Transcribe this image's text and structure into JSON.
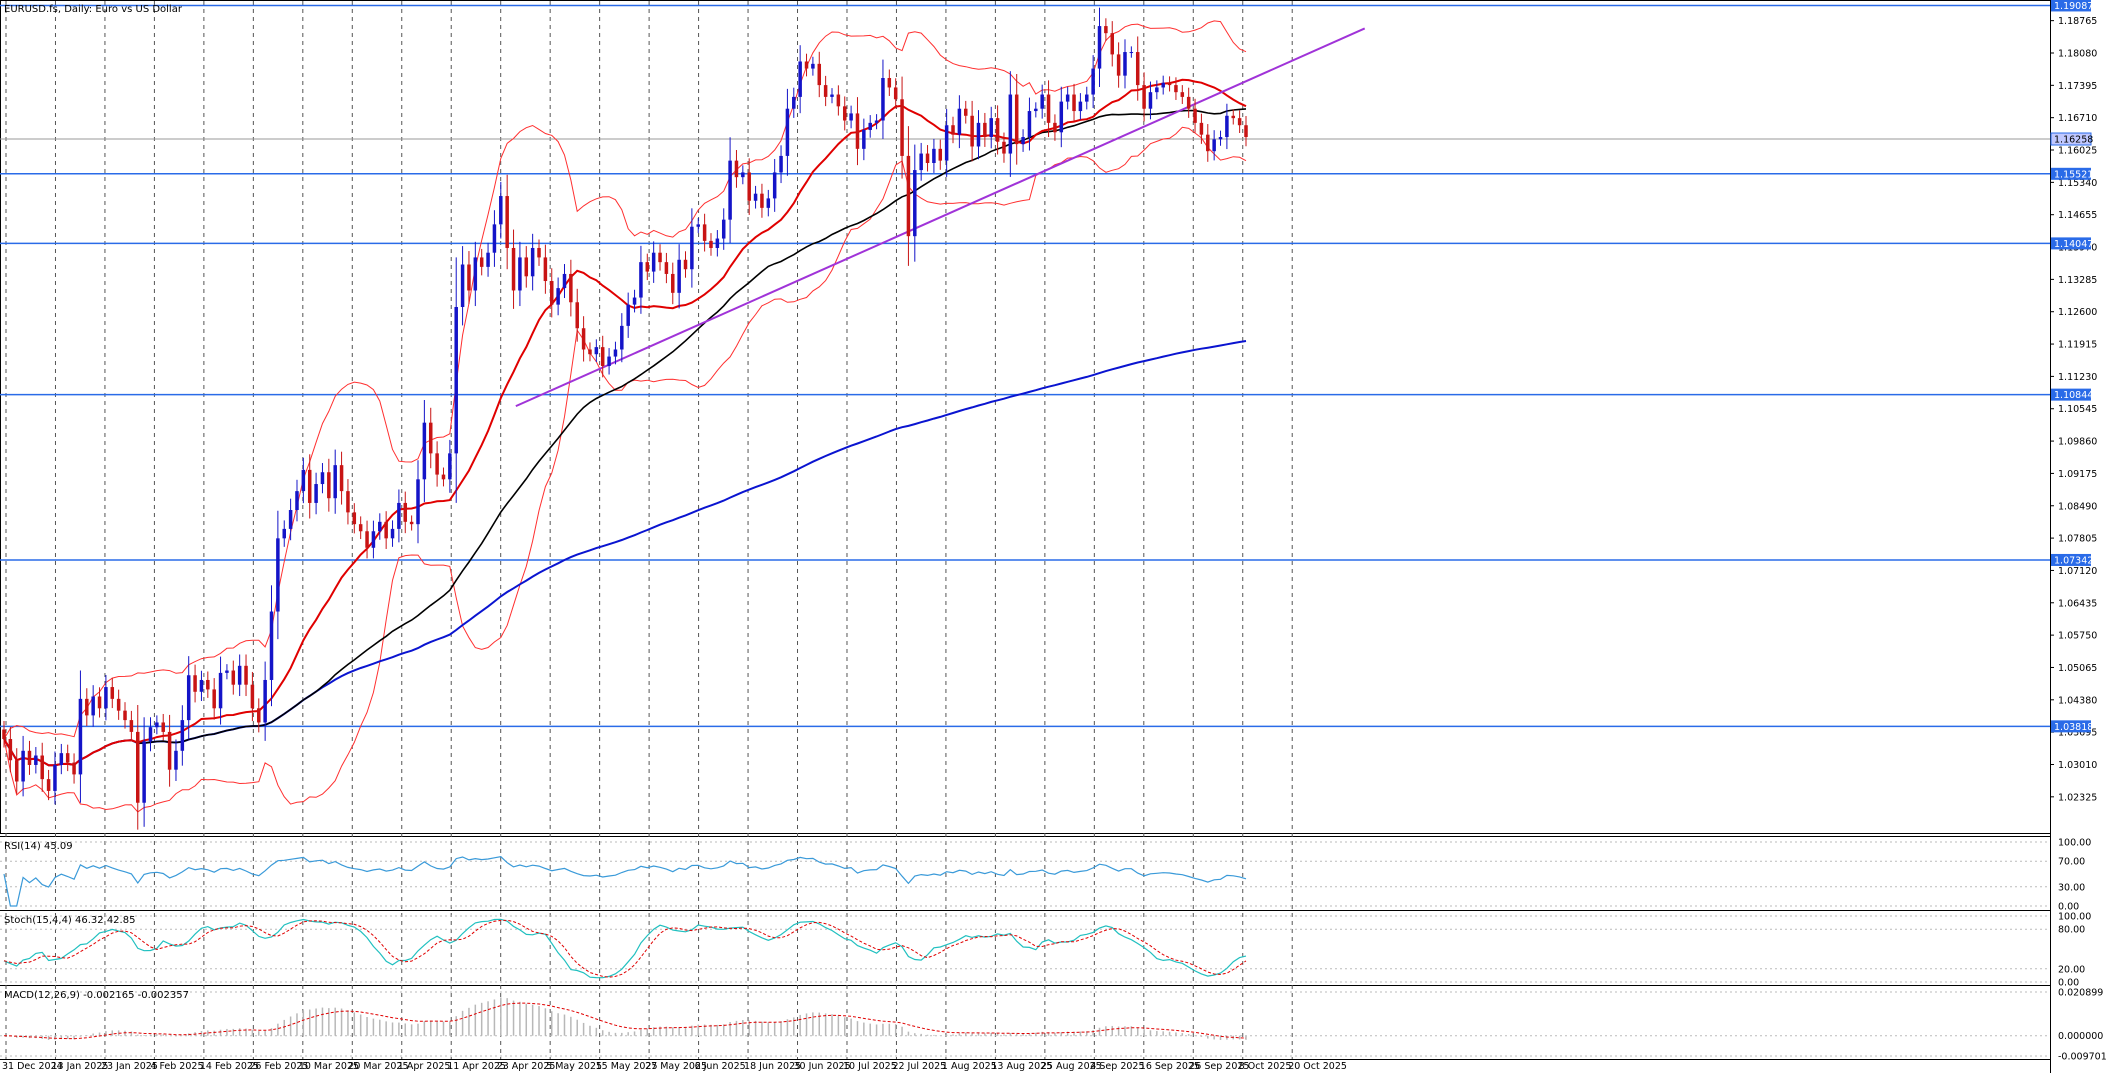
{
  "chart_title": "EURUSD.fs, Daily:  Euro vs US Dollar",
  "colors": {
    "bull": "#1414c8",
    "bear": "#c81414",
    "bb": "#ff3030",
    "ma_fast": "#e00000",
    "ma_mid": "#000000",
    "ma_slow": "#0a14d0",
    "trend": "#a033d8",
    "hlines": "#2a6be8",
    "rsi": "#3a9ad9",
    "stoch_main": "#21c0c0",
    "stoch_signal": "#e00000",
    "macd_hist": "#b8b8b8",
    "macd_signal": "#e00000"
  },
  "chart_data": {
    "type": "candlestick",
    "price_axis_labels": [
      "1.18765",
      "1.18080",
      "1.17395",
      "1.16710",
      "1.16025",
      "1.15340",
      "1.14655",
      "1.13970",
      "1.13285",
      "1.12600",
      "1.11915",
      "1.11230",
      "1.10545",
      "1.09860",
      "1.09175",
      "1.08490",
      "1.07805",
      "1.07120",
      "1.06435",
      "1.05750",
      "1.05065",
      "1.04380",
      "1.03695",
      "1.03010",
      "1.02325"
    ],
    "ylim": [
      1.0158,
      1.1916
    ],
    "horizontal_levels": [
      "1.19087",
      "1.15521",
      "1.14047",
      "1.10844",
      "1.07342",
      "1.03818"
    ],
    "current_price": "1.16258",
    "date_labels": [
      "31 Dec 2024",
      "13 Jan 2025",
      "23 Jan 2025",
      "4 Feb 2025",
      "14 Feb 2025",
      "26 Feb 2025",
      "10 Mar 2025",
      "20 Mar 2025",
      "1 Apr 2025",
      "11 Apr 2025",
      "23 Apr 2025",
      "5 May 2025",
      "15 May 2025",
      "27 May 2025",
      "6 Jun 2025",
      "18 Jun 2025",
      "30 Jun 2025",
      "10 Jul 2025",
      "22 Jul 2025",
      "1 Aug 2025",
      "13 Aug 2025",
      "25 Aug 2025",
      "4 Sep 2025",
      "16 Sep 2025",
      "26 Sep 2025",
      "8 Oct 2025",
      "20 Oct 2025"
    ],
    "closes": [
      1.0355,
      1.031,
      1.0265,
      1.033,
      1.03,
      1.032,
      1.027,
      1.0245,
      1.03,
      1.0325,
      1.0305,
      1.028,
      1.044,
      1.0405,
      1.0445,
      1.042,
      1.0465,
      1.044,
      1.0415,
      1.0395,
      1.037,
      1.022,
      1.035,
      1.038,
      1.039,
      1.037,
      1.029,
      1.033,
      1.0395,
      1.049,
      1.0455,
      1.048,
      1.046,
      1.042,
      1.0495,
      1.05,
      1.047,
      1.051,
      1.047,
      1.042,
      1.039,
      1.048,
      1.0625,
      1.078,
      1.08,
      1.084,
      1.088,
      1.0925,
      1.0855,
      1.0895,
      1.092,
      1.0865,
      1.0935,
      1.088,
      1.0835,
      1.081,
      1.0795,
      1.076,
      1.0795,
      1.0815,
      1.078,
      1.08,
      1.0855,
      1.0815,
      1.081,
      1.0905,
      1.1025,
      1.096,
      1.0915,
      1.0905,
      1.096,
      1.127,
      1.136,
      1.1305,
      1.1375,
      1.1355,
      1.1385,
      1.1445,
      1.1505,
      1.1395,
      1.1305,
      1.1375,
      1.1335,
      1.1395,
      1.1375,
      1.1325,
      1.1275,
      1.131,
      1.134,
      1.128,
      1.1225,
      1.118,
      1.117,
      1.1185,
      1.1145,
      1.1165,
      1.118,
      1.123,
      1.1275,
      1.129,
      1.1365,
      1.1345,
      1.1385,
      1.1365,
      1.134,
      1.13,
      1.137,
      1.135,
      1.144,
      1.1445,
      1.141,
      1.1395,
      1.1415,
      1.1455,
      1.158,
      1.1545,
      1.1555,
      1.1495,
      1.151,
      1.148,
      1.15,
      1.1555,
      1.159,
      1.169,
      1.1715,
      1.179,
      1.1775,
      1.1785,
      1.174,
      1.1715,
      1.172,
      1.1695,
      1.1665,
      1.168,
      1.1605,
      1.1645,
      1.166,
      1.1665,
      1.1755,
      1.1735,
      1.171,
      1.159,
      1.142,
      1.156,
      1.1595,
      1.1575,
      1.1605,
      1.158,
      1.1655,
      1.1635,
      1.169,
      1.1675,
      1.161,
      1.166,
      1.163,
      1.167,
      1.162,
      1.1595,
      1.172,
      1.1615,
      1.163,
      1.1685,
      1.169,
      1.172,
      1.166,
      1.164,
      1.1705,
      1.172,
      1.1685,
      1.1705,
      1.172,
      1.1775,
      1.1865,
      1.185,
      1.1805,
      1.176,
      1.181,
      1.181,
      1.174,
      1.169,
      1.1725,
      1.1735,
      1.1745,
      1.174,
      1.1725,
      1.1715,
      1.169,
      1.166,
      1.1635,
      1.16,
      1.1625,
      1.163,
      1.1675,
      1.167,
      1.1655,
      1.163
    ]
  },
  "indicators": {
    "rsi": {
      "label": "RSI(14) 45.09",
      "axis_labels": [
        "100.00",
        "70.00",
        "30.00",
        "0.00"
      ]
    },
    "stochastic": {
      "label": "Stoch(15,4,4) 46.32 42.85",
      "axis_labels": [
        "100.00",
        "80.00",
        "20.00",
        "0.00"
      ]
    },
    "macd": {
      "label": "MACD(12,26,9) -0.002165 -0.002357",
      "axis_labels": [
        "0.020899",
        "0.000000",
        "-0.009701"
      ]
    }
  }
}
